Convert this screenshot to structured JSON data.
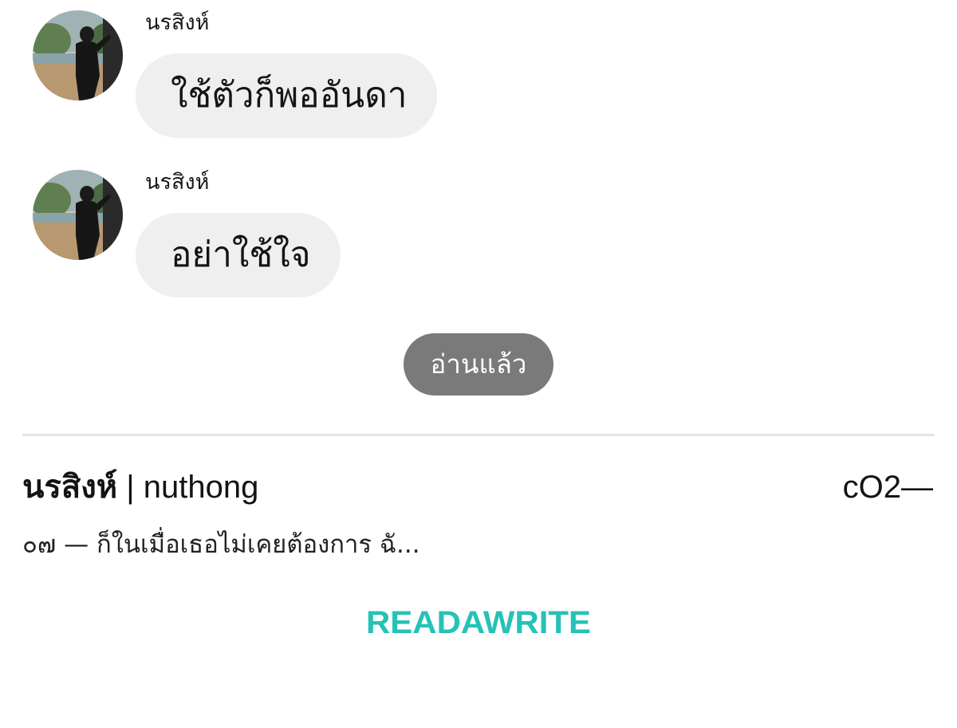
{
  "messages": [
    {
      "sender": "นรสิงห์",
      "text": "ใช้ตัวก็พออันดา",
      "avatar_icon": "user-photo-avatar"
    },
    {
      "sender": "นรสิงห์",
      "text": "อย่าใช้ใจ",
      "avatar_icon": "user-photo-avatar"
    }
  ],
  "read_status": "อ่านแล้ว",
  "preview": {
    "author_thai": "นรสิงห์",
    "author_separator": " | ",
    "author_latin": "nuthong",
    "code": "cO2—",
    "excerpt": "๐๗ — ก็ในเมื่อเธอไม่เคยต้องการ ฉั..."
  },
  "brand": {
    "name": "READAWRITE",
    "color": "#25c2b6"
  },
  "colors": {
    "bubble": "#efefef",
    "read_badge": "#7a7a7a",
    "divider": "#e4e4e4"
  }
}
